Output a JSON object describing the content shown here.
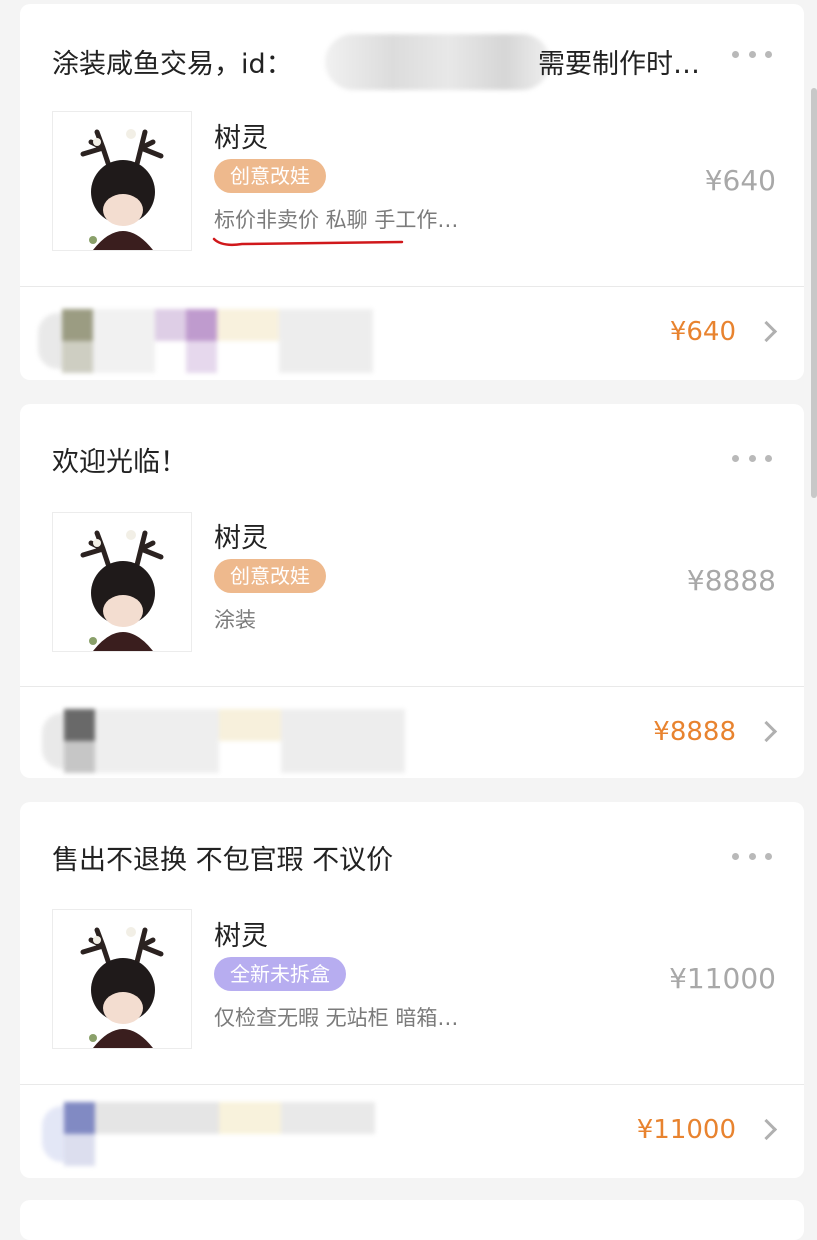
{
  "cards": [
    {
      "title_start": "涂装咸鱼交易，id：",
      "title_end": "需要制作时…",
      "item_name": "树灵",
      "tag": "创意改娃",
      "description": "标价非卖价 私聊 手工作…",
      "price": "¥640",
      "total_price": "¥640"
    },
    {
      "title": "欢迎光临！",
      "item_name": "树灵",
      "tag": "创意改娃",
      "description": "涂装",
      "price": "¥8888",
      "total_price": "¥8888"
    },
    {
      "title": "售出不退换 不包官瑕 不议价",
      "item_name": "树灵",
      "tag": "全新未拆盒",
      "description": "仅检查无暇 无站柜 暗箱…",
      "price": "¥11000",
      "total_price": "¥11000"
    }
  ],
  "colors": {
    "tag_orange": "#eeb98d",
    "tag_purple": "#b7adf0",
    "total_price": "#e8832f",
    "list_price": "#a8a8a8",
    "annotation_underline": "#d0181b"
  },
  "icons": {
    "more": "more-dots-icon",
    "chevron": "chevron-right-icon"
  }
}
